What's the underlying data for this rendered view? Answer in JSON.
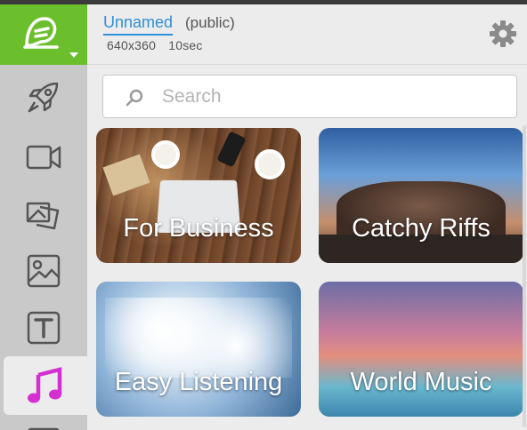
{
  "header": {
    "project_name": "Unnamed",
    "visibility": "(public)",
    "resolution": "640x360",
    "duration": "10sec"
  },
  "sidebar": {
    "items": [
      {
        "icon": "rocket-icon"
      },
      {
        "icon": "video-camera-icon"
      },
      {
        "icon": "transitions-icon"
      },
      {
        "icon": "image-icon"
      },
      {
        "icon": "text-icon"
      },
      {
        "icon": "music-note-icon",
        "active": true
      }
    ]
  },
  "search": {
    "placeholder": "Search"
  },
  "categories": [
    {
      "label": "For Business"
    },
    {
      "label": "Catchy Riffs"
    },
    {
      "label": "Easy Listening"
    },
    {
      "label": "World Music"
    }
  ],
  "colors": {
    "brand_green": "#6cbf2c",
    "link_blue": "#2f8fd8",
    "active_icon_magenta": "#d42fd0"
  }
}
